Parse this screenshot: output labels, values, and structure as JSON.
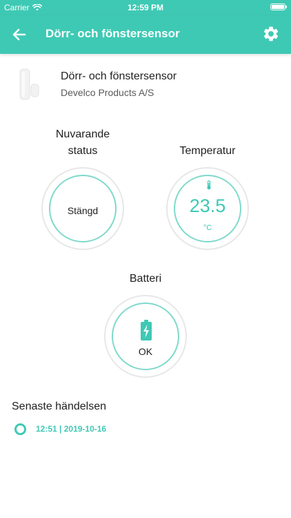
{
  "status_bar": {
    "carrier": "Carrier",
    "time": "12:59 PM",
    "icons": [
      "wifi-icon",
      "battery-icon"
    ]
  },
  "nav": {
    "title": "Dörr- och fönstersensor",
    "back_icon": "arrow-left-icon",
    "settings_icon": "gear-icon"
  },
  "device": {
    "name": "Dörr- och fönstersensor",
    "manufacturer": "Develco Products A/S",
    "image_icon": "door-sensor-icon"
  },
  "status_gauge": {
    "label_line1": "Nuvarande",
    "label_line2": "status",
    "value": "Stängd"
  },
  "temperature_gauge": {
    "label": "Temperatur",
    "value": "23.5",
    "unit": "°C",
    "icon": "thermometer-icon"
  },
  "battery_gauge": {
    "label": "Batteri",
    "value": "OK",
    "icon": "battery-charging-icon"
  },
  "last_event": {
    "title": "Senaste händelsen",
    "time": "12:51 | 2019-10-16"
  },
  "colors": {
    "accent": "#3ec9b4",
    "ring_outer": "#e7e7e7",
    "ring_inner": "#7fd9cb"
  }
}
